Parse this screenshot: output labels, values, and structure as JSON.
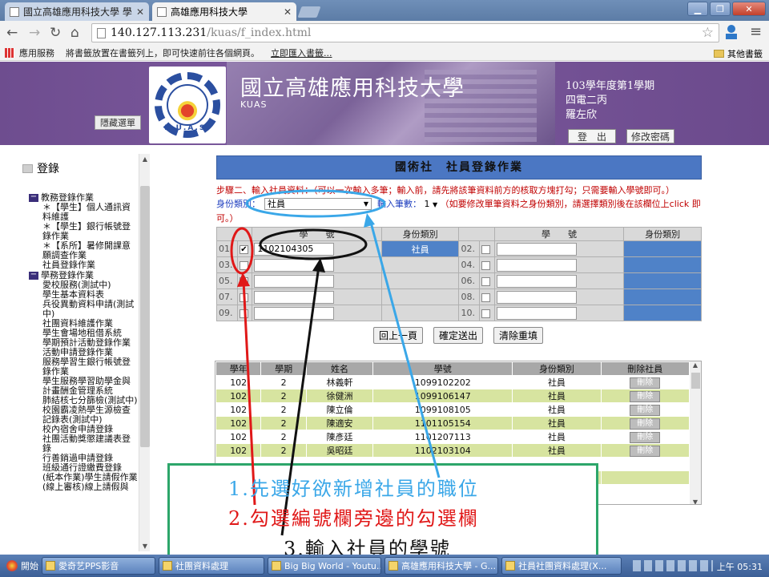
{
  "browser": {
    "tabs": [
      {
        "label": "國立高雄應用科技大學 學"
      },
      {
        "label": "高雄應用科技大學"
      }
    ],
    "url_host": "140.127.113.231",
    "url_path": "/kuas/f_index.html",
    "bookmarks": {
      "apps": "應用服務",
      "hint": "將書籤放置在書籤列上，即可快速前往各個網頁。",
      "import": "立即匯入書籤...",
      "other": "其他書籤"
    }
  },
  "banner": {
    "school_name": "國立高雄應用科技大學",
    "school_abbr": "KUAS",
    "logo_letters": "K.U.A.S.",
    "hide_menu": "隱藏選單",
    "term": "103學年度第1學期",
    "class": "四電二丙",
    "user": "羅左欣",
    "logout": "登　出",
    "change_password": "修改密碼"
  },
  "sidebar": {
    "title": "登錄",
    "groups": [
      {
        "label": "教務登錄作業",
        "items": [
          "＊【學生】個人通訊資料維護",
          "＊【學生】銀行帳號登錄作業",
          "＊【系所】暑修開課意願調查作業",
          "社員登錄作業"
        ]
      },
      {
        "label": "學務登錄作業",
        "items": [
          "愛校服務(測試中)",
          "學生基本資料表",
          "兵役異動資料申請(測試中)",
          "社團資料維護作業",
          "學生會場地租借系統",
          "學期預計活動登錄作業",
          "活動申請登錄作業",
          "服務學習生銀行帳號登錄作業",
          "學生服務學習助學金與計畫酬金管理系統",
          "肺結核七分篩檢(測試中)",
          "校園霸凌熱學生源檢查記錄表(測試中)",
          "校內宿舍申請登錄",
          "社團活動獎懲建議表登錄",
          "行善銷過申請登錄",
          "班級通行證繳費登錄",
          "(紙本作業)學生請假作業",
          "(線上審核)線上請假與"
        ]
      }
    ]
  },
  "form": {
    "title": "國術社　社員登錄作業",
    "instruction": "步驟二、輸入社員資料：（可以一次輸入多筆；輸入前，請先將該筆資料前方的核取方塊打勾；只需要輸入學號即可。）",
    "role_label": "身份類別：",
    "role_value": "社員",
    "count_label": "輸入筆數：",
    "count_value": "1",
    "role_note": "（如要修改單筆資料之身份類別，請選擇類別後在該欄位上click 即可。）",
    "headers": {
      "id": "學　　號",
      "role": "身份類別"
    },
    "rows": [
      {
        "left": {
          "no": "01.",
          "checked": "✔",
          "id": "1102104305",
          "role": "社員"
        },
        "right": {
          "no": "02.",
          "checked": "",
          "id": "",
          "role": ""
        }
      },
      {
        "left": {
          "no": "03.",
          "checked": "",
          "id": "",
          "role": ""
        },
        "right": {
          "no": "04.",
          "checked": "",
          "id": "",
          "role": ""
        }
      },
      {
        "left": {
          "no": "05.",
          "checked": "",
          "id": "",
          "role": ""
        },
        "right": {
          "no": "06.",
          "checked": "",
          "id": "",
          "role": ""
        }
      },
      {
        "left": {
          "no": "07.",
          "checked": "",
          "id": "",
          "role": ""
        },
        "right": {
          "no": "08.",
          "checked": "",
          "id": "",
          "role": ""
        }
      },
      {
        "left": {
          "no": "09.",
          "checked": "",
          "id": "",
          "role": ""
        },
        "right": {
          "no": "10.",
          "checked": "",
          "id": "",
          "role": ""
        }
      }
    ],
    "buttons": {
      "back": "回上一頁",
      "submit": "確定送出",
      "clear": "清除重填"
    }
  },
  "members": {
    "headers": [
      "學年",
      "學期",
      "姓名",
      "學號",
      "身份類別",
      "刪除社員"
    ],
    "delete_label": "刪除",
    "rows": [
      [
        "102",
        "2",
        "林義軒",
        "1099102202",
        "社員"
      ],
      [
        "102",
        "2",
        "徐健洲",
        "1099106147",
        "社員"
      ],
      [
        "102",
        "2",
        "陳立倫",
        "1099108105",
        "社員"
      ],
      [
        "102",
        "2",
        "陳適安",
        "1101105154",
        "社員"
      ],
      [
        "102",
        "2",
        "陳彥廷",
        "1101207113",
        "社員"
      ],
      [
        "102",
        "2",
        "吳昭廷",
        "1102103104",
        "社員"
      ],
      [
        "",
        "",
        "",
        "",
        ""
      ],
      [
        "",
        "",
        "",
        "",
        ""
      ],
      [
        "",
        "",
        "",
        "",
        ""
      ]
    ]
  },
  "annotations": {
    "step1": "1.先選好欲新增社員的職位",
    "step2": "2.勾選編號欄旁邊的勾選欄",
    "step3": "3.輸入社員的學號",
    "colors": {
      "step1": "#3aa7e8",
      "step2": "#e01818",
      "step3": "#111111",
      "box": "#2da66a"
    }
  },
  "taskbar": {
    "start": "開始",
    "tasks": [
      "愛奇艺PPS影音",
      "社團資料處理",
      "Big Big World - Youtu...",
      "高雄應用科技大學 - G...",
      "社員社團資料處理(X..."
    ],
    "clock": "上午 05:31"
  }
}
